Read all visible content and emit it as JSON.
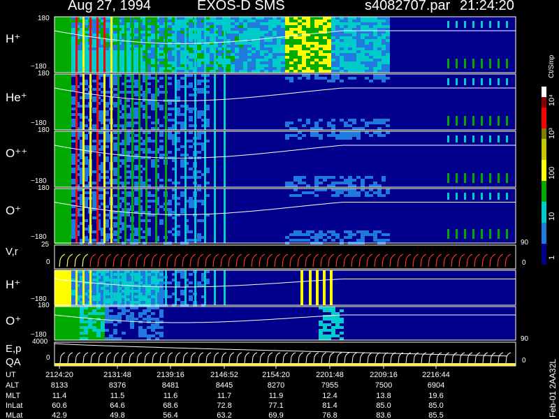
{
  "header": {
    "date": "Aug 27, 1994",
    "mission": "EXOS-D SMS",
    "filename": "s4082707.par",
    "time": "21:24:20"
  },
  "colorbar": {
    "title": "Ct/Smp",
    "tick_labels": [
      "10⁴",
      "10³",
      "100",
      "10",
      "1"
    ],
    "colors": [
      "#ffffff",
      "#8b0000",
      "#ff0000",
      "#808000",
      "#c8c800",
      "#ffff00",
      "#00aa00",
      "#00cccc",
      "#1e7adc",
      "#00008c"
    ]
  },
  "panels": [
    {
      "label": "H⁺",
      "ticks": [
        "180",
        "−180"
      ]
    },
    {
      "label": "He⁺",
      "ticks": [
        "180",
        "−180"
      ]
    },
    {
      "label": "O⁺⁺",
      "ticks": [
        "180",
        "−180"
      ]
    },
    {
      "label": "O⁺",
      "ticks": [
        "180",
        "−180"
      ]
    },
    {
      "label": "V,r",
      "ticks": [
        "25",
        "0"
      ],
      "right_ticks": [
        "90",
        "0"
      ]
    },
    {
      "label": "H⁺",
      "ticks": [
        "−180"
      ]
    },
    {
      "label": "O⁺",
      "ticks": [
        "180",
        "−180"
      ],
      "right_ticks": [
        "90"
      ]
    },
    {
      "label": "E,p",
      "ticks": [
        "4000"
      ]
    },
    {
      "label": "QA",
      "ticks": [
        "0"
      ],
      "right_ticks": [
        "0"
      ]
    }
  ],
  "orbit_table": {
    "rows": [
      {
        "name": "UT",
        "values": [
          "2124:20",
          "2131:48",
          "2139:16",
          "2146:52",
          "2154:20",
          "2201:48",
          "2209:16",
          "2216:44"
        ]
      },
      {
        "name": "ALT",
        "values": [
          "8133",
          "8376",
          "8481",
          "8445",
          "8270",
          "7955",
          "7500",
          "6904"
        ]
      },
      {
        "name": "MLT",
        "values": [
          "11.4",
          "11.5",
          "11.6",
          "11.7",
          "11.9",
          "12.4",
          "13.8",
          "19.6"
        ]
      },
      {
        "name": "InLat",
        "values": [
          "60.6",
          "64.6",
          "68.6",
          "72.8",
          "77.1",
          "81.4",
          "85.0",
          "85.0"
        ]
      },
      {
        "name": "MLat",
        "values": [
          "42.9",
          "49.8",
          "56.4",
          "63.2",
          "69.9",
          "76.8",
          "83.6",
          "85.5"
        ]
      }
    ]
  },
  "side_text": "Feb-01 2AA32L",
  "chart_data": {
    "type": "heatmap",
    "title": "Aug 27, 1994   EXOS-D SMS   s4082707.par   21:24:20",
    "x_tick_labels": [
      "2124:20",
      "2131:48",
      "2139:16",
      "2146:52",
      "2154:20",
      "2201:48",
      "2209:16",
      "2216:44"
    ],
    "colorbar_label": "Ct/Smp",
    "colorbar_scale": "log",
    "colorbar_range": [
      1,
      10000
    ],
    "panels": [
      {
        "label": "H⁺",
        "ylim": [
          -180,
          180
        ]
      },
      {
        "label": "He⁺",
        "ylim": [
          -180,
          180
        ]
      },
      {
        "label": "O⁺⁺",
        "ylim": [
          -180,
          180
        ]
      },
      {
        "label": "O⁺",
        "ylim": [
          -180,
          180
        ]
      },
      {
        "label": "V,r",
        "ylim": [
          0,
          25
        ],
        "y2lim": [
          0,
          90
        ]
      },
      {
        "label": "H⁺",
        "ylim": [
          -180,
          180
        ]
      },
      {
        "label": "O⁺",
        "ylim": [
          -180,
          180
        ],
        "y2lim": [
          0,
          90
        ]
      },
      {
        "label": "E,p",
        "ylim": [
          0,
          4000
        ]
      },
      {
        "label": "QA",
        "ylim": [
          0,
          0
        ]
      }
    ]
  }
}
